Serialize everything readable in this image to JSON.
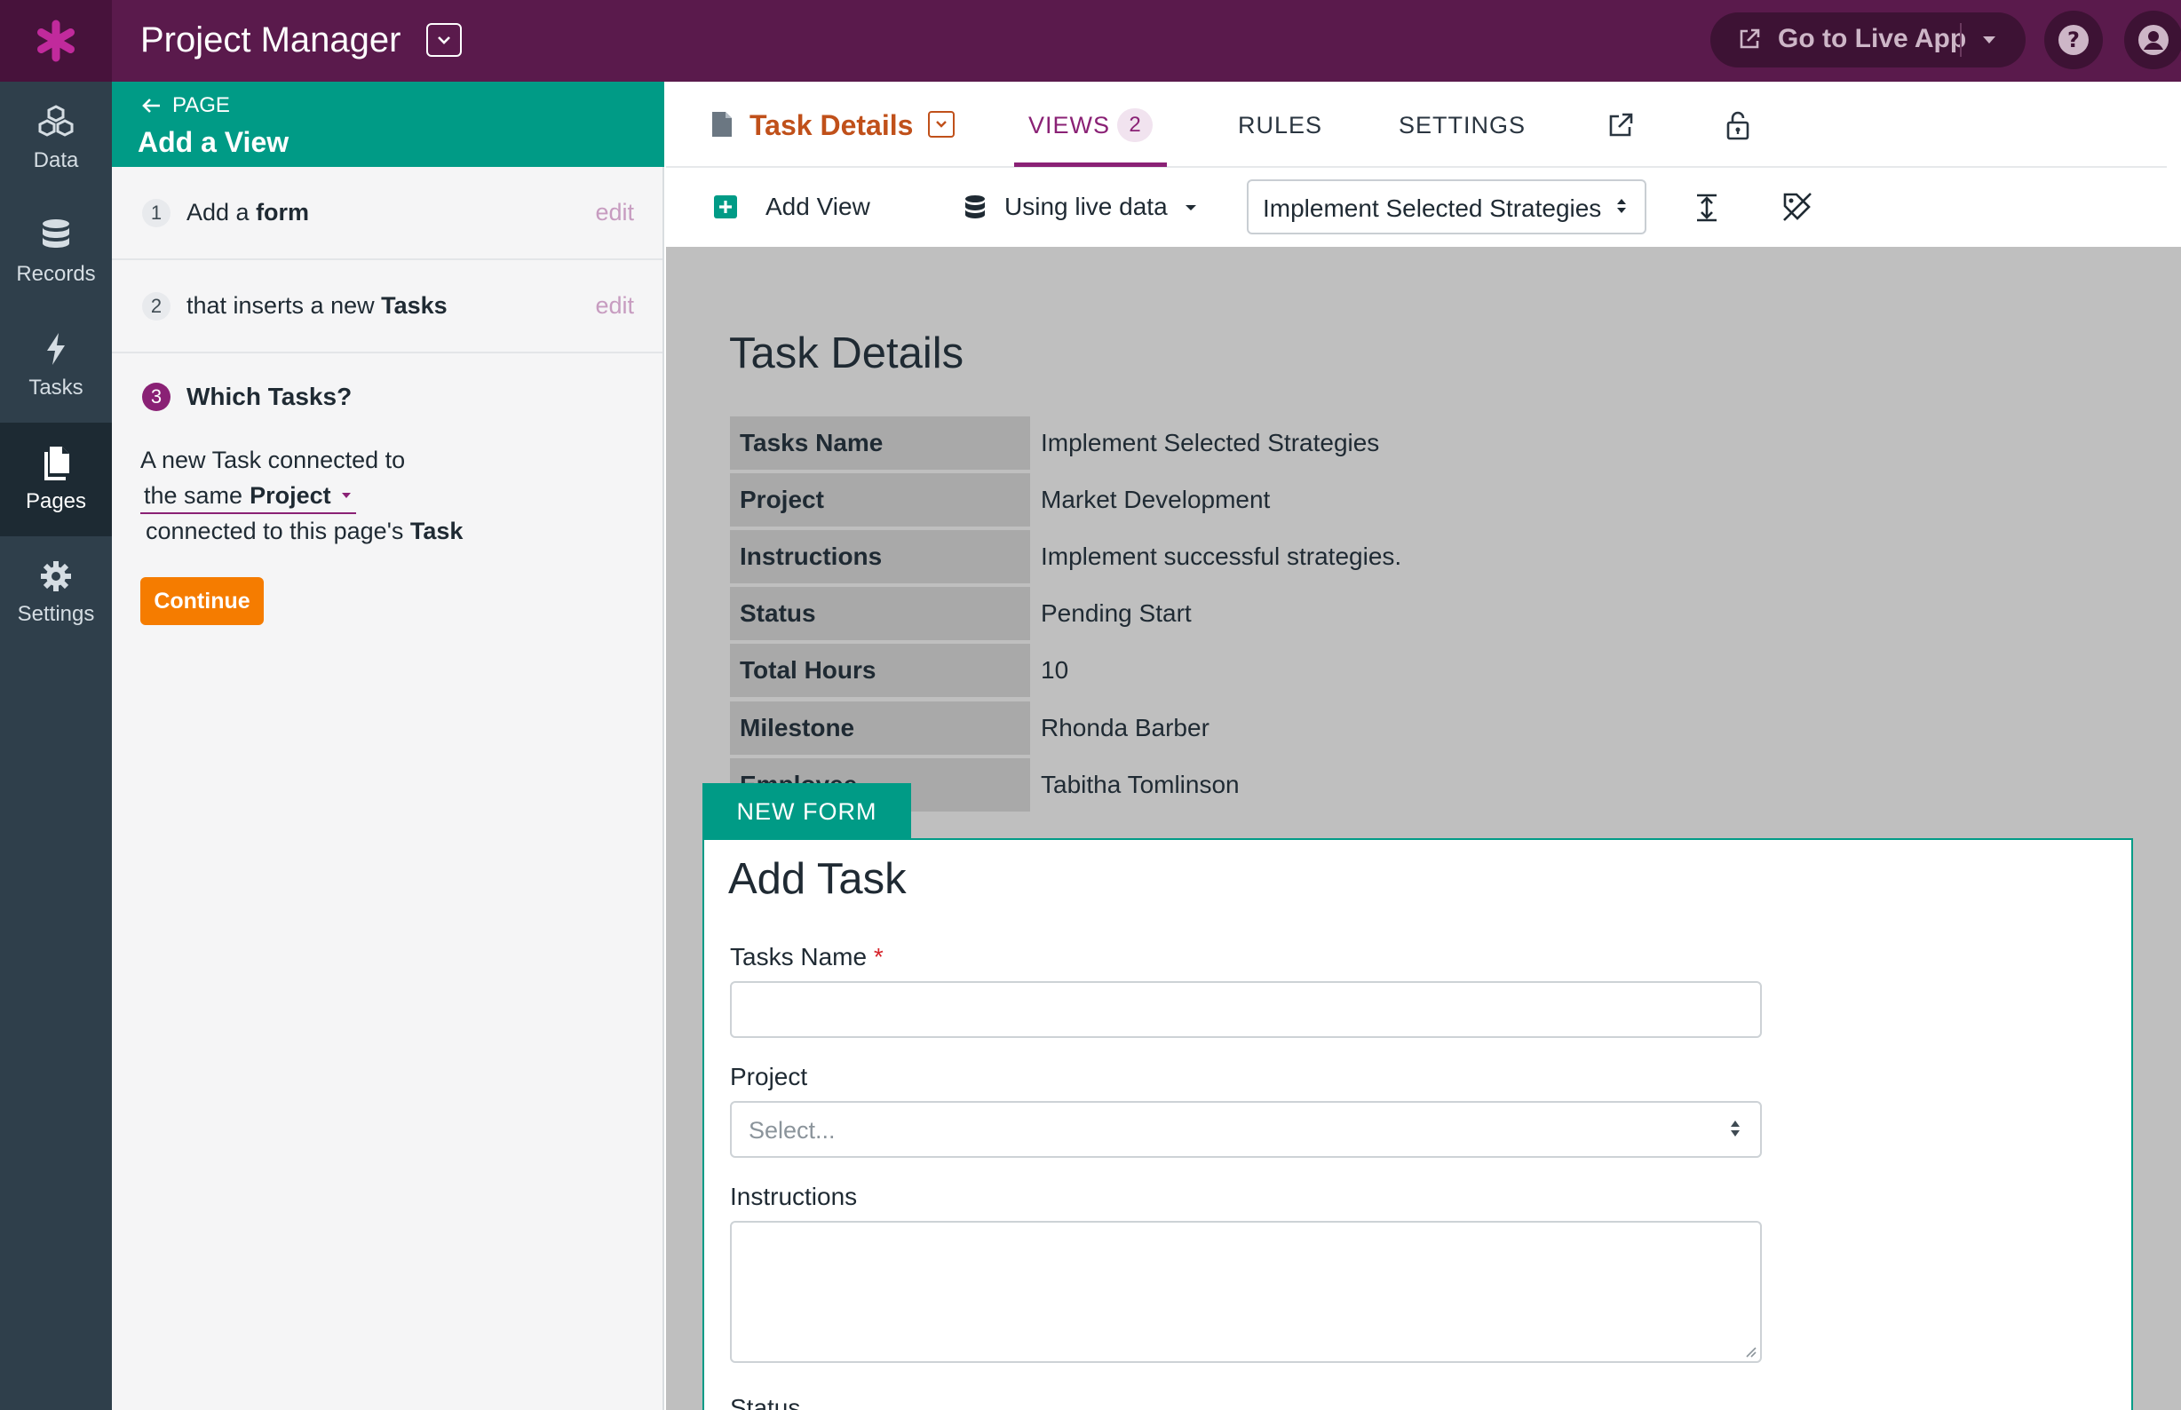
{
  "app": {
    "title": "Project Manager",
    "go_live_label": "Go to Live App"
  },
  "colors": {
    "topbar": "#5a1a4c",
    "nav": "#2f3f4b",
    "teal": "#009b86",
    "page_accent": "#c0501a",
    "tab_accent": "#8a2175",
    "continue": "#f57c00"
  },
  "nav": {
    "items": [
      {
        "label": "Data",
        "icon": "cubes-icon"
      },
      {
        "label": "Records",
        "icon": "database-icon"
      },
      {
        "label": "Tasks",
        "icon": "bolt-icon"
      },
      {
        "label": "Pages",
        "icon": "pages-icon",
        "active": true
      },
      {
        "label": "Settings",
        "icon": "gear-icon"
      }
    ]
  },
  "panel": {
    "back_label": "PAGE",
    "title": "Add a View",
    "steps": [
      {
        "num": "1",
        "text_before": "Add a ",
        "text_bold": "form",
        "edit": "edit"
      },
      {
        "num": "2",
        "text_before": "that inserts a new ",
        "text_bold": "Tasks",
        "edit": "edit"
      }
    ],
    "step3": {
      "num": "3",
      "title": "Which Tasks?",
      "line1": "A new Task connected to",
      "select_prefix": "the same ",
      "select_bold": "Project",
      "line3_prefix": "connected to this page's ",
      "line3_bold": "Task"
    },
    "continue_label": "Continue"
  },
  "header": {
    "page_name": "Task Details",
    "tabs": {
      "views": "VIEWS",
      "views_count": "2",
      "rules": "RULES",
      "settings": "SETTINGS"
    },
    "toolbar": {
      "add_view": "Add View",
      "live_data": "Using live data",
      "record_select": "Implement Selected Strategies"
    }
  },
  "details": {
    "title": "Task Details",
    "rows": [
      {
        "label": "Tasks Name",
        "value": "Implement Selected Strategies"
      },
      {
        "label": "Project",
        "value": "Market Development"
      },
      {
        "label": "Instructions",
        "value": "Implement successful strategies."
      },
      {
        "label": "Status",
        "value": "Pending Start"
      },
      {
        "label": "Total Hours",
        "value": "10"
      },
      {
        "label": "Milestone",
        "value": "Rhonda Barber"
      },
      {
        "label": "Employee",
        "value": "Tabitha Tomlinson"
      }
    ]
  },
  "form": {
    "tab_label": "NEW FORM",
    "title": "Add Task",
    "fields": {
      "tasks_name": "Tasks Name",
      "required_mark": "*",
      "project": "Project",
      "project_placeholder": "Select...",
      "instructions": "Instructions",
      "status": "Status"
    }
  }
}
